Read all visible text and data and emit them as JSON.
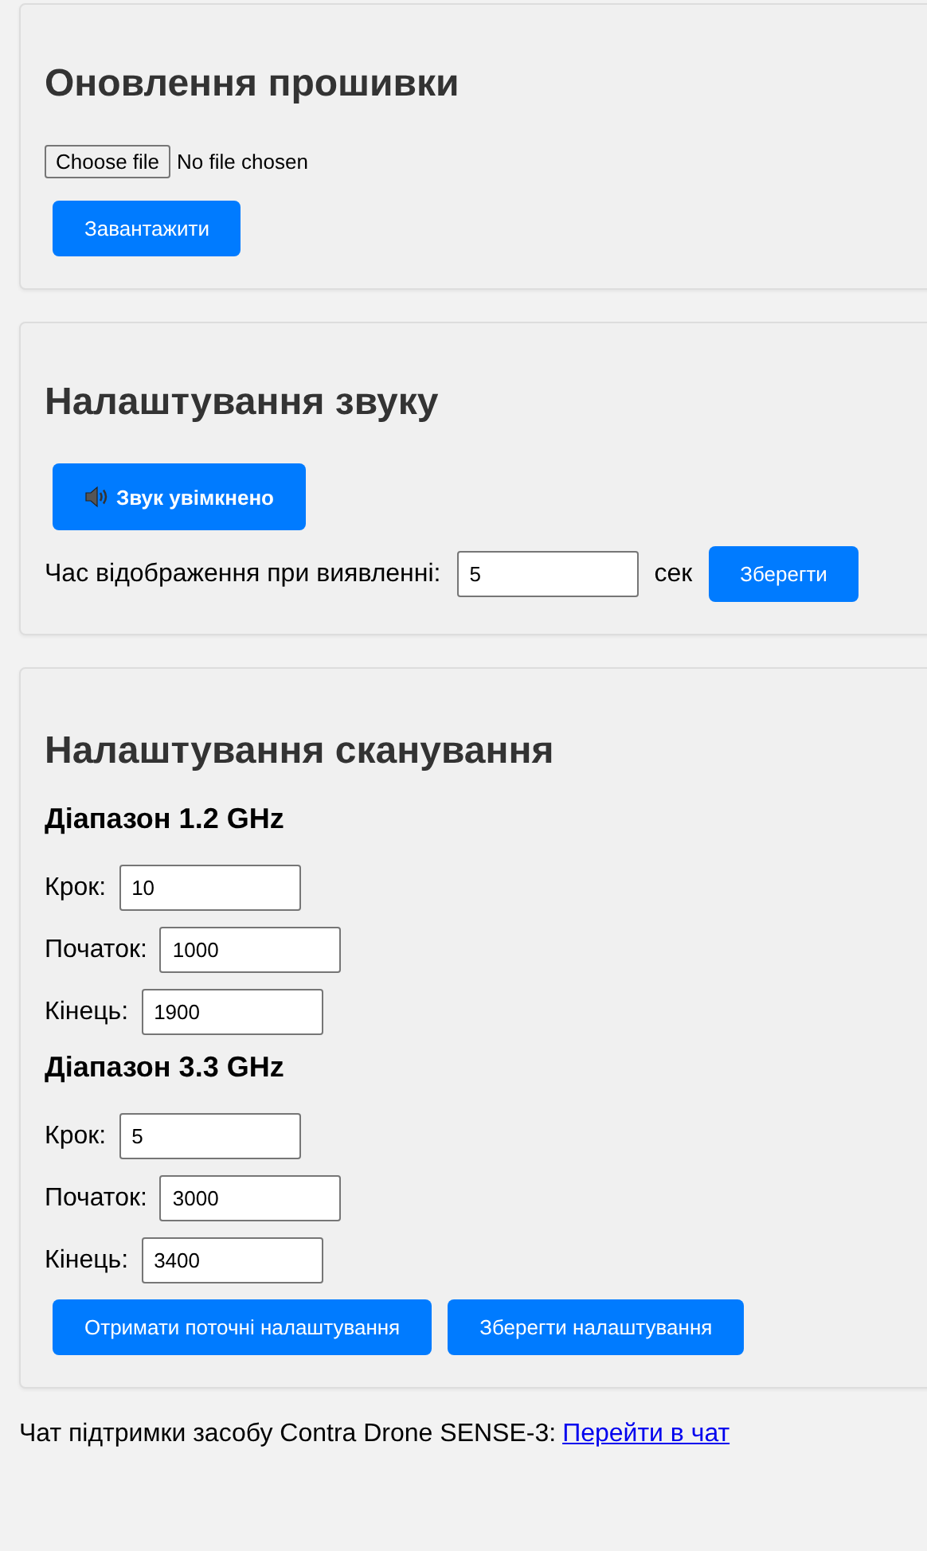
{
  "firmware": {
    "title": "Оновлення прошивки",
    "file_button": "Choose file",
    "file_status": "No file chosen",
    "upload_button": "Завантажити"
  },
  "sound": {
    "title": "Налаштування звуку",
    "toggle": {
      "label": "Звук увімкнено",
      "on": true
    },
    "duration_label": "Час відображення при виявленні:",
    "duration_value": "5",
    "unit": "сек",
    "save_button": "Зберегти"
  },
  "scan": {
    "title": "Налаштування сканування",
    "ranges": [
      {
        "title": "Діапазон 1.2 GHz",
        "fields": [
          {
            "label": "Крок:",
            "value": "10"
          },
          {
            "label": "Початок:",
            "value": "1000"
          },
          {
            "label": "Кінець:",
            "value": "1900"
          }
        ]
      },
      {
        "title": "Діапазон 3.3 GHz",
        "fields": [
          {
            "label": "Крок:",
            "value": "5"
          },
          {
            "label": "Початок:",
            "value": "3000"
          },
          {
            "label": "Кінець:",
            "value": "3400"
          }
        ]
      }
    ],
    "buttons": [
      "Отримати поточні налаштування",
      "Зберегти налаштування"
    ]
  },
  "footer": {
    "text": "Чат підтримки засобу Contra Drone SENSE-3:",
    "link": "Перейти в чат"
  }
}
